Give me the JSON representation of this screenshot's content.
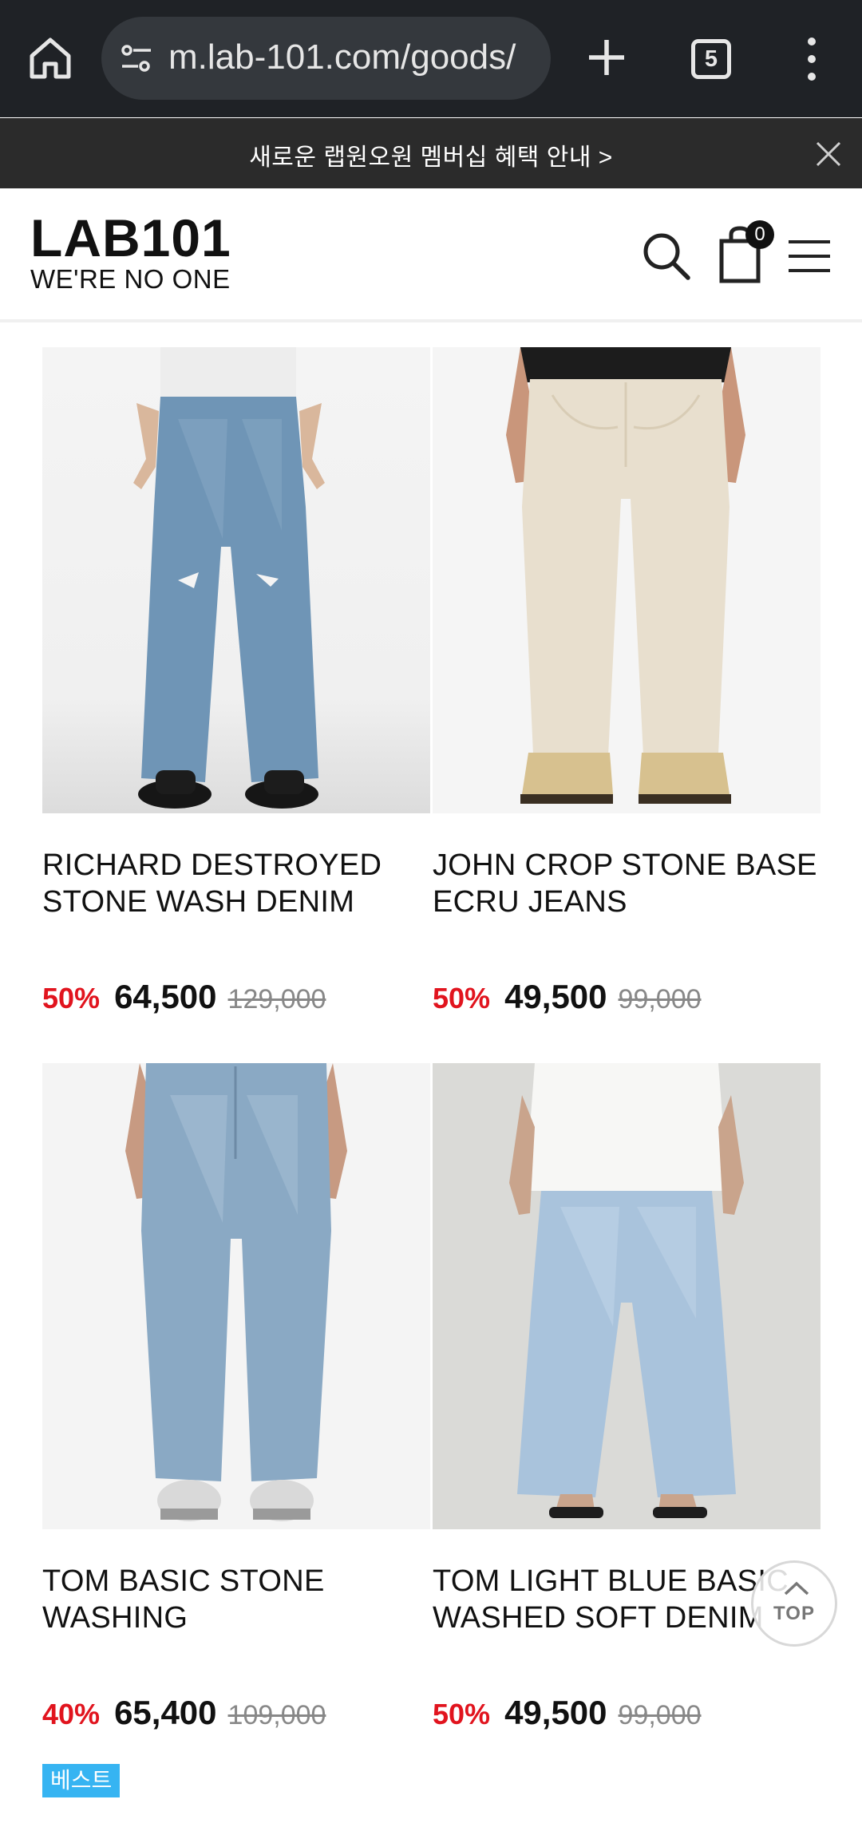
{
  "browser": {
    "url": "m.lab-101.com/goods/",
    "tab_count": "5"
  },
  "banner": {
    "text": "새로운 랩원오원 멤버십 혜택 안내 >"
  },
  "header": {
    "logo_main": "LAB101",
    "logo_tagline": "WE'RE NO ONE",
    "cart_count": "0"
  },
  "products": [
    {
      "name": "RICHARD DESTROYED\nSTONE WASH DENIM",
      "discount": "50%",
      "price": "64,500",
      "original_price": "129,000",
      "badge": ""
    },
    {
      "name": "JOHN CROP STONE BASE\nECRU JEANS",
      "discount": "50%",
      "price": "49,500",
      "original_price": "99,000",
      "badge": ""
    },
    {
      "name": "TOM BASIC STONE\nWASHING",
      "discount": "40%",
      "price": "65,400",
      "original_price": "109,000",
      "badge": "베스트"
    },
    {
      "name": "TOM LIGHT BLUE BASIC\nWASHED SOFT DENIM",
      "discount": "50%",
      "price": "49,500",
      "original_price": "99,000",
      "badge": ""
    }
  ],
  "top_button": {
    "label": "TOP"
  },
  "colors": {
    "discount": "#e1141e",
    "badge": "#36b4f2",
    "banner_bg": "#2b2b2b",
    "chrome_bg": "#1f2226"
  }
}
